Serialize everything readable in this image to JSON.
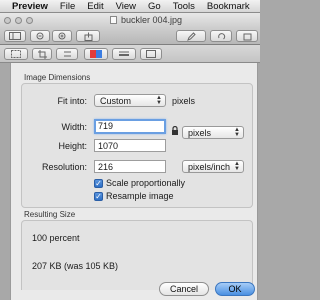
{
  "menubar": {
    "app_name": "Preview",
    "items": [
      "File",
      "Edit",
      "View",
      "Go",
      "Tools",
      "Bookmark"
    ]
  },
  "window": {
    "title": "buckler 004.jpg"
  },
  "dialog": {
    "dimensions_group_title": "Image Dimensions",
    "fit_into_label": "Fit into:",
    "fit_into_value": "Custom",
    "fit_into_unit": "pixels",
    "width_label": "Width:",
    "width_value": "719",
    "height_label": "Height:",
    "height_value": "1070",
    "size_unit_value": "pixels",
    "resolution_label": "Resolution:",
    "resolution_value": "216",
    "resolution_unit_value": "pixels/inch",
    "scale_label": "Scale proportionally",
    "scale_checked": true,
    "resample_label": "Resample image",
    "resample_checked": true,
    "result_group_title": "Resulting Size",
    "result_percent": "100 percent",
    "result_size": "207 KB (was 105 KB)",
    "cancel_label": "Cancel",
    "ok_label": "OK"
  },
  "colors": {
    "accent": "#4a90e2",
    "focus_ring": "#6a9fe2"
  }
}
